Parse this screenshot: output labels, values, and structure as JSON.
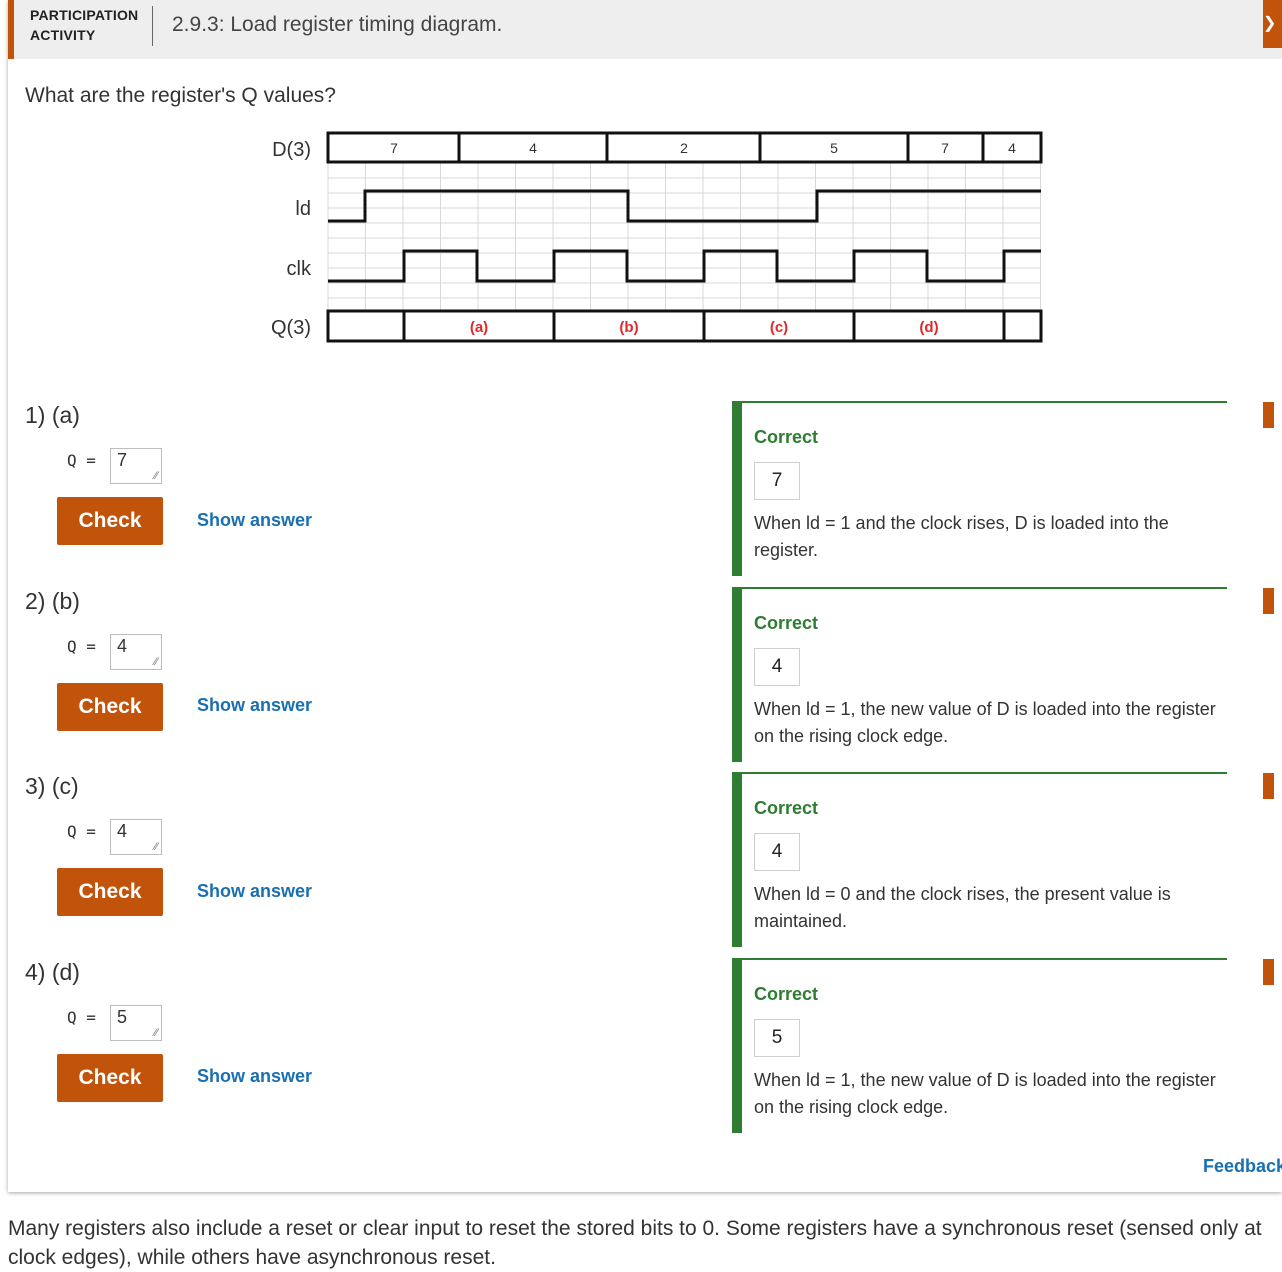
{
  "activity": {
    "type_label": "PARTICIPATION ACTIVITY",
    "title": "2.9.3: Load register timing diagram.",
    "prompt": "What are the register's Q values?"
  },
  "diagram": {
    "signals": [
      "D(3)",
      "ld",
      "clk",
      "Q(3)"
    ],
    "d_values": [
      "7",
      "4",
      "2",
      "5",
      "7",
      "4"
    ],
    "q_labels": [
      "(a)",
      "(b)",
      "(c)",
      "(d)"
    ],
    "q_label_color": "#e3262b"
  },
  "questions": [
    {
      "number": "1)",
      "part": "(a)",
      "q_label": "Q =",
      "value": "7",
      "check_label": "Check",
      "show_answer_label": "Show answer",
      "status": "Correct",
      "answer": "7",
      "explanation": "When ld = 1 and the clock rises, D is loaded into the register."
    },
    {
      "number": "2)",
      "part": "(b)",
      "q_label": "Q =",
      "value": "4",
      "check_label": "Check",
      "show_answer_label": "Show answer",
      "status": "Correct",
      "answer": "4",
      "explanation": "When ld = 1, the new value of D is loaded into the register on the rising clock edge."
    },
    {
      "number": "3)",
      "part": "(c)",
      "q_label": "Q =",
      "value": "4",
      "check_label": "Check",
      "show_answer_label": "Show answer",
      "status": "Correct",
      "answer": "4",
      "explanation": "When ld = 0 and the clock rises, the present value is maintained."
    },
    {
      "number": "4)",
      "part": "(d)",
      "q_label": "Q =",
      "value": "5",
      "check_label": "Check",
      "show_answer_label": "Show answer",
      "status": "Correct",
      "answer": "5",
      "explanation": "When ld = 1, the new value of D is loaded into the register on the rising clock edge."
    }
  ],
  "feedback_link": "Feedback",
  "body_text": "Many registers also include a reset or clear input to reset the stored bits to 0. Some registers have a synchronous reset (sensed only at clock edges), while others have asynchronous reset.",
  "colors": {
    "accent": "#c2530a",
    "correct": "#2e7d32",
    "link": "#1a6fb0"
  }
}
